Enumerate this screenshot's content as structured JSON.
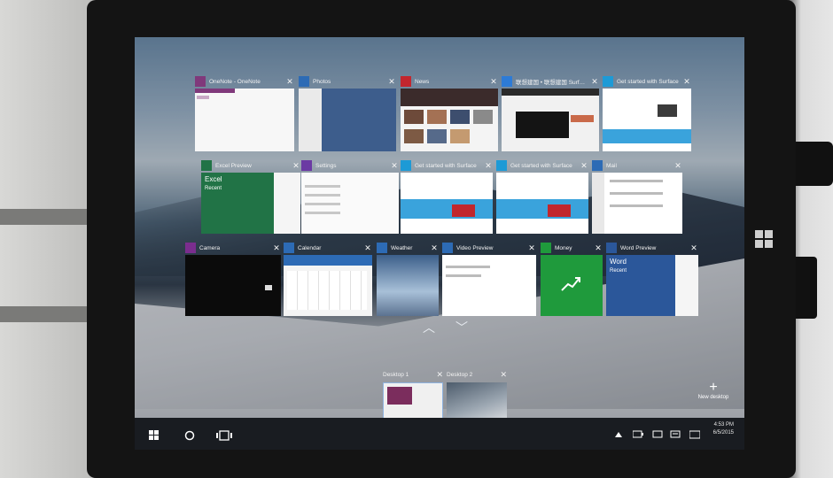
{
  "row1": [
    {
      "title": "OneNote - OneNote",
      "icon": "onenote-icon",
      "color": "#80397b"
    },
    {
      "title": "Photos",
      "icon": "photos-icon",
      "color": "#2d6bb5"
    },
    {
      "title": "News",
      "icon": "news-icon",
      "color": "#c3262e"
    },
    {
      "title": "联想建国 • 联想建国 Surface",
      "icon": "edge-icon",
      "color": "#2d7bd6"
    },
    {
      "title": "Get started with Surface",
      "icon": "ie-icon",
      "color": "#1d9ad6"
    }
  ],
  "row2": [
    {
      "title": "Excel Preview",
      "icon": "excel-icon",
      "color": "#217346"
    },
    {
      "title": "Settings",
      "icon": "gear-icon",
      "color": "#6b3aa3"
    },
    {
      "title": "Get started with Surface",
      "icon": "ie-icon",
      "color": "#1d9ad6"
    },
    {
      "title": "Get started with Surface",
      "icon": "ie-icon",
      "color": "#1d9ad6"
    },
    {
      "title": "Mail",
      "icon": "mail-icon",
      "color": "#2d6bb5"
    }
  ],
  "row3": [
    {
      "title": "Camera",
      "icon": "camera-icon",
      "color": "#7b2d8e"
    },
    {
      "title": "Calendar",
      "icon": "calendar-icon",
      "color": "#2d6bb5"
    },
    {
      "title": "Weather",
      "icon": "weather-icon",
      "color": "#2d6bb5"
    },
    {
      "title": "Video Preview",
      "icon": "video-icon",
      "color": "#2d6bb5"
    },
    {
      "title": "Money",
      "icon": "money-icon",
      "color": "#1f9a3c"
    },
    {
      "title": "Word Preview",
      "icon": "word-icon",
      "color": "#2b579a"
    }
  ],
  "excel": {
    "app_name": "Excel",
    "recent": "Recent"
  },
  "word": {
    "app_name": "Word",
    "recent": "Recent"
  },
  "desktops": [
    {
      "label": "Desktop 1"
    },
    {
      "label": "Desktop 2"
    }
  ],
  "new_desktop": {
    "label": "New desktop",
    "symbol": "+"
  },
  "close_symbol": "✕",
  "nav": {
    "up": "︿",
    "down": "﹀"
  },
  "taskbar": {
    "time": "4:53 PM",
    "date": "6/5/2015"
  }
}
